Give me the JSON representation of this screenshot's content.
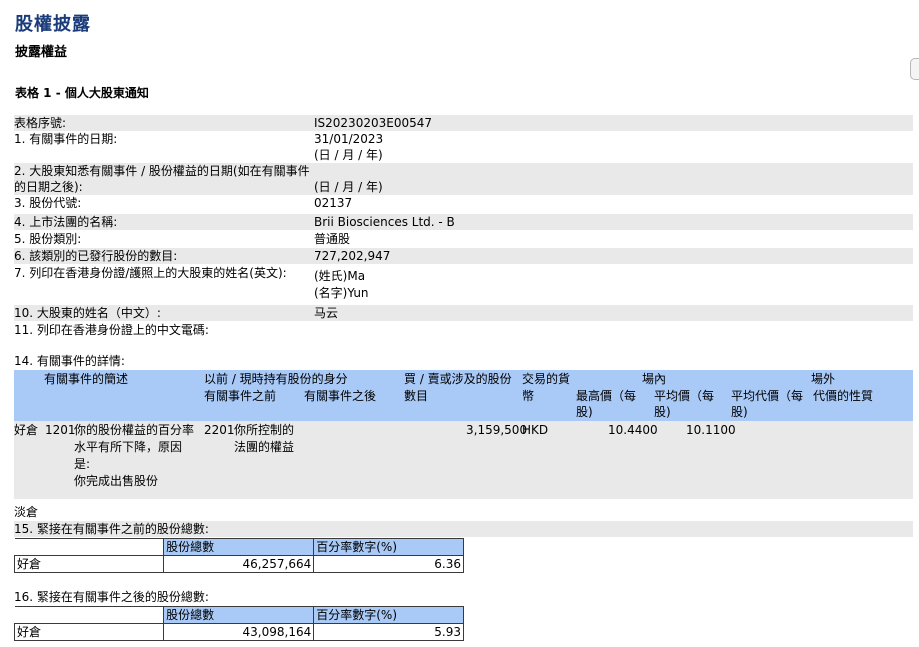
{
  "page": {
    "title": "股權披露",
    "subtitle": "披露權益",
    "section_title": "表格 1 - 個人大股東通知"
  },
  "fields": [
    {
      "label": "表格序號:",
      "value": "IS20230203E00547"
    },
    {
      "label": "1. 有關事件的日期:",
      "value": "31/01/2023",
      "value2": "(日 / 月 / 年)"
    },
    {
      "label": "2. 大股東知悉有關事件 / 股份權益的日期(如在有關事件",
      "label2": "的日期之後):",
      "value": "(日 / 月 / 年)"
    },
    {
      "label": "3. 股份代號:",
      "value": "02137"
    },
    {
      "label": "4. 上市法團的名稱:",
      "value": "Brii Biosciences Ltd. - B"
    },
    {
      "label": "5. 股份類別:",
      "value": "普通股"
    },
    {
      "label": "6. 該類別的已發行股份的數目:",
      "value": "727,202,947"
    },
    {
      "label": "7. 列印在香港身份證/護照上的大股東的姓名(英文):",
      "value": "(姓氏)Ma",
      "value2": "(名字)Yun"
    },
    {
      "label": "10. 大股東的姓名（中文）:",
      "value": "马云"
    },
    {
      "label": "11. 列印在香港身份證上的中文電碼:",
      "value": ""
    }
  ],
  "event_details": {
    "heading": "14. 有關事件的詳情:",
    "headers": {
      "desc": "有關事件的簡述",
      "capacity": "以前 / 現時持有股份的身分",
      "before": "有關事件之前",
      "after": "有關事件之後",
      "shares1": "買 / 賣或涉及的股份",
      "shares2": "數目",
      "currency1": "交易的貨",
      "currency2": "幣",
      "onexchange": "場內",
      "offexchange": "場外",
      "highest1": "最高價（每",
      "highest2": "股)",
      "avg1": "平均價（每",
      "avg2": "股)",
      "avgconsid1": "平均代價（每",
      "avgconsid2": "股)",
      "nature": "代價的性質"
    },
    "row": {
      "position": "好倉",
      "code": "1201",
      "desc_lines": [
        "你的股份權益的百分率",
        "水平有所下降，原因",
        "是:",
        "你完成出售股份"
      ],
      "capacity_code": "2201",
      "capacity_lines": [
        "你所控制的",
        "法團的權益"
      ],
      "shares": "3,159,500",
      "currency": "HKD",
      "highest": "10.4400",
      "average": "10.1100"
    },
    "short_label": "淡倉"
  },
  "before_total": {
    "heading": "15. 緊接在有關事件之前的股份總數:",
    "col1": "股份總數",
    "col2": "百分率數字(%)",
    "row_label": "好倉",
    "shares": "46,257,664",
    "percent": "6.36"
  },
  "after_total": {
    "heading": "16. 緊接在有關事件之後的股份總數:",
    "col1": "股份總數",
    "col2": "百分率數字(%)",
    "row_label": "好倉",
    "shares": "43,098,164",
    "percent": "5.93"
  }
}
